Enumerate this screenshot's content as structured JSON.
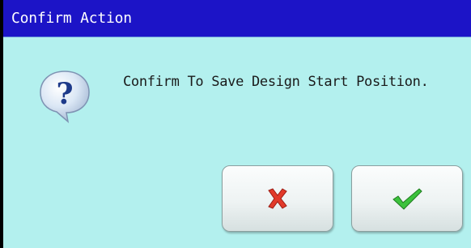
{
  "dialog": {
    "title": "Confirm Action",
    "message": "Confirm To Save Design Start Position.",
    "icon": "question-icon",
    "buttons": {
      "cancel": {
        "icon": "red-x-icon",
        "color": "#e23a2a"
      },
      "confirm": {
        "icon": "green-check-icon",
        "color": "#3cc23c"
      }
    }
  },
  "colors": {
    "title_bar": "#1c14c7",
    "background": "#b3f0ee",
    "title_text": "#ffffff"
  }
}
